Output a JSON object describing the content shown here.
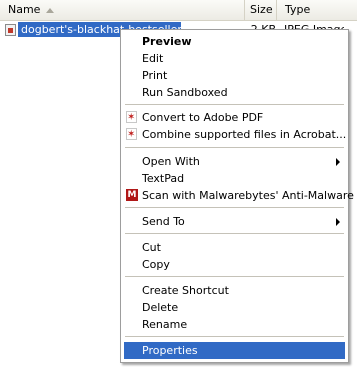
{
  "header": {
    "name_col": "Name",
    "size_col": "Size",
    "type_col": "Type"
  },
  "file": {
    "name": "dogbert's-blackhat-bestseller",
    "size": "2 KB",
    "type": "JPEG Image"
  },
  "menu": {
    "preview": "Preview",
    "edit": "Edit",
    "print": "Print",
    "run_sandboxed": "Run Sandboxed",
    "convert_pdf": "Convert to Adobe PDF",
    "combine_acrobat": "Combine supported files in Acrobat...",
    "open_with": "Open With",
    "textpad": "TextPad",
    "scan_mb": "Scan with Malwarebytes' Anti-Malware",
    "send_to": "Send To",
    "cut": "Cut",
    "copy": "Copy",
    "create_shortcut": "Create Shortcut",
    "delete": "Delete",
    "rename": "Rename",
    "properties": "Properties"
  },
  "icons": {
    "file": "image-file-icon",
    "pdf": "adobe-pdf-icon",
    "malwarebytes": "malwarebytes-icon"
  },
  "colors": {
    "selection": "#316ac5",
    "selection_text": "#ffffff"
  }
}
